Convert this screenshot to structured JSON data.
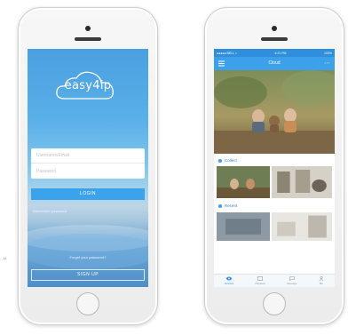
{
  "login": {
    "brand": "easy4ip",
    "username_placeholder": "Username/Email",
    "password_placeholder": "Password",
    "login_button": "LOGIN",
    "remember": "Remember password",
    "forgot": "Forget your password?",
    "signup_button": "SIGN UP"
  },
  "gallery": {
    "status_left": "●●●●● BELL ≈",
    "status_time": "4:21 PM",
    "status_right": "100%",
    "title": "Cloud",
    "section_collect": "Collect",
    "section_recent": "Recent",
    "tabs": [
      {
        "label": "Devices"
      },
      {
        "label": "Playback"
      },
      {
        "label": "Message"
      },
      {
        "label": "Me"
      }
    ]
  },
  "side_mark": "U",
  "colors": {
    "accent": "#3da0ea",
    "login_gradient_top": "#4a9fe0",
    "login_button": "#3aa3ec"
  }
}
